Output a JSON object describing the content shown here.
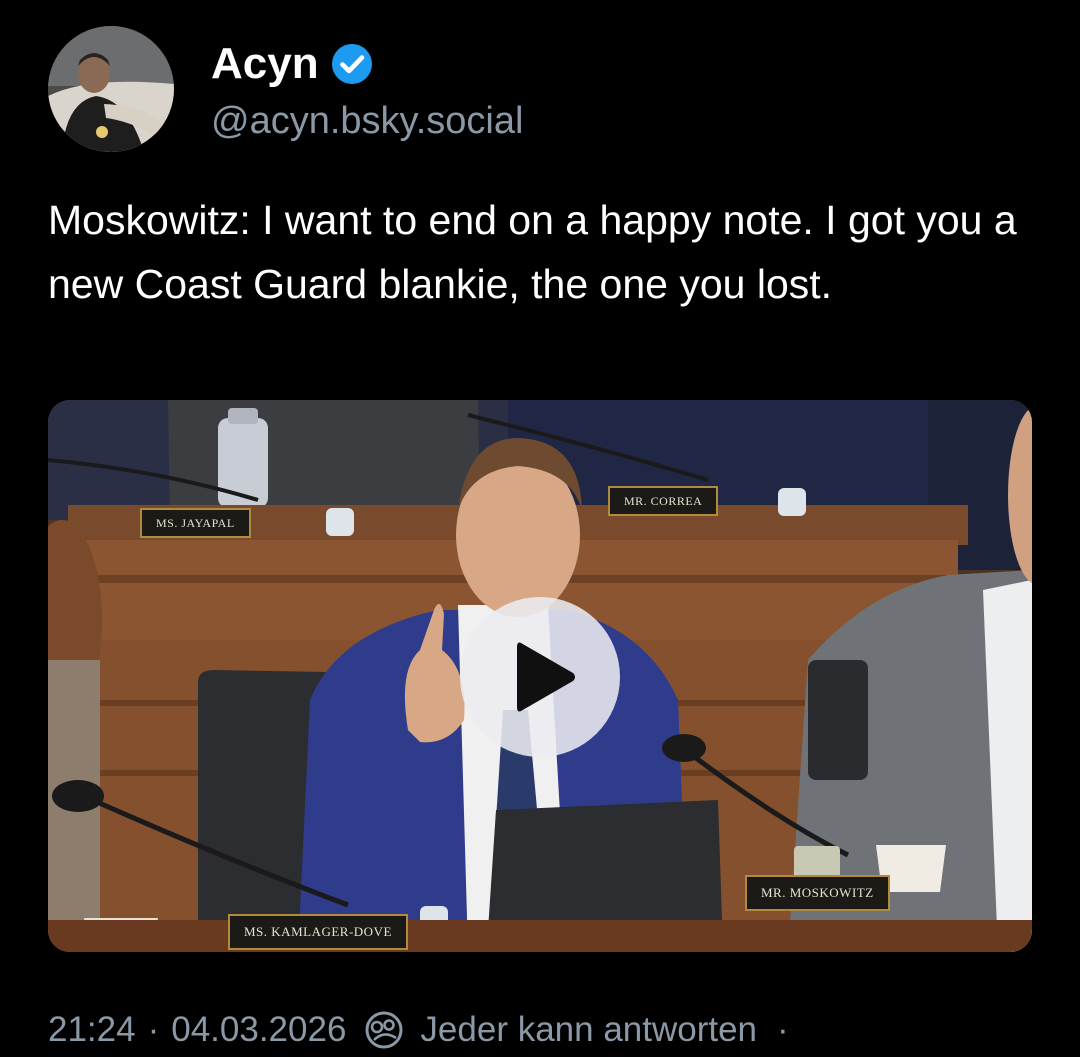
{
  "author": {
    "display_name": "Acyn",
    "handle": "@acyn.bsky.social",
    "verified": true,
    "verified_color": "#1d9bf0",
    "avatar_icon": "user-avatar"
  },
  "post": {
    "text": "Moskowitz: I want to end on a happy note. I got you a new Coast Guard blankie, the one you lost."
  },
  "video": {
    "nameplates": {
      "jayapal": "MS. JAYAPAL",
      "correa": "MR. CORREA",
      "moskowitz": "MR. MOSKOWITZ",
      "kamlager": "MS. KAMLAGER-DOVE"
    },
    "play_icon": "play-icon"
  },
  "meta": {
    "time": "21:24",
    "separator": "·",
    "date": "04.03.2026",
    "reply_icon": "reply-permission-icon",
    "reply_setting": "Jeder kann antworten",
    "trailing_dot": "·"
  },
  "colors": {
    "background": "#000000",
    "text": "#ffffff",
    "muted": "#8b98a5"
  }
}
